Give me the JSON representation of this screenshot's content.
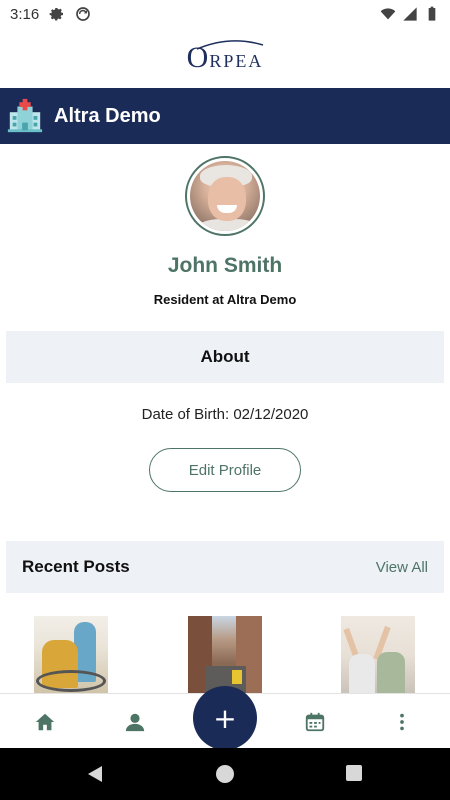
{
  "status_bar": {
    "time": "3:16",
    "icons": [
      "gear-icon",
      "sync-icon",
      "wifi-icon",
      "signal-icon",
      "battery-icon"
    ]
  },
  "logo": {
    "first_letter": "O",
    "rest": "RPEA"
  },
  "header": {
    "title": "Altra Demo",
    "icon": "building-icon"
  },
  "profile": {
    "name": "John Smith",
    "subtitle": "Resident at Altra Demo"
  },
  "about": {
    "section_title": "About",
    "dob_text": "Date of Birth: 02/12/2020",
    "edit_button": "Edit Profile"
  },
  "recent_posts": {
    "title": "Recent Posts",
    "view_all": "View All"
  },
  "bottom_nav": {
    "items": [
      "home-icon",
      "profile-icon",
      "add-icon",
      "calendar-icon",
      "more-icon"
    ],
    "fab_label": "+"
  },
  "colors": {
    "primary_dark": "#1b2b57",
    "accent_green": "#4e7466",
    "section_bg": "#eef2f7"
  }
}
